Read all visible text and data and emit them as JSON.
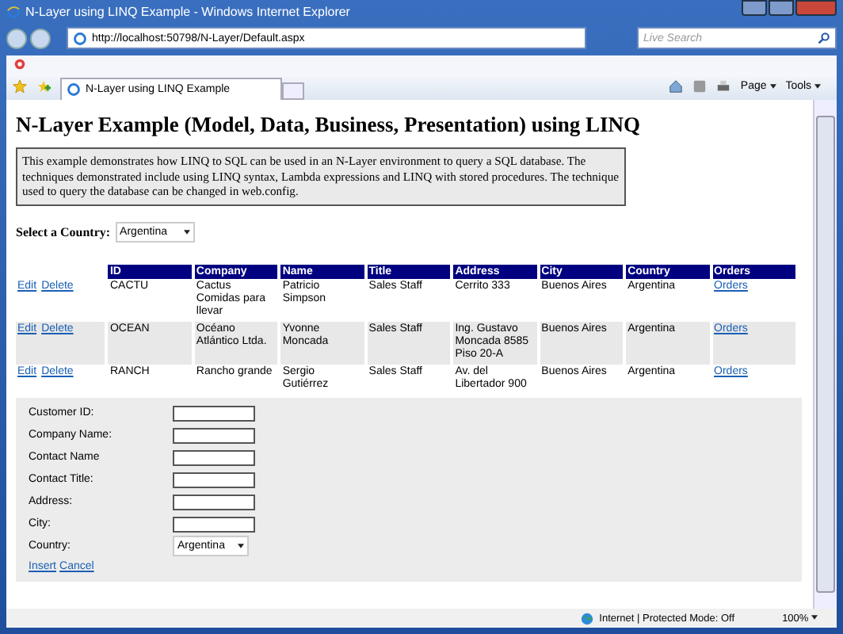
{
  "window": {
    "title": "N-Layer using LINQ Example - Windows Internet Explorer"
  },
  "browser": {
    "address": "http://localhost:50798/N-Layer/Default.aspx",
    "search_placeholder": "Live Search",
    "tab_title": "N-Layer using LINQ Example",
    "menus": [
      "Page",
      "Tools"
    ]
  },
  "page": {
    "heading": "N-Layer Example (Model, Data, Business, Presentation) using LINQ",
    "description": "This example demonstrates how LINQ to SQL can be used in an N-Layer environment to query a SQL database. The techniques demonstrated include using LINQ syntax, Lambda expressions and LINQ with stored procedures. The technique used to query the database can be changed in web.config.",
    "country_label": "Select a Country:",
    "country_value": "Argentina"
  },
  "table": {
    "columns": [
      "ID",
      "Company",
      "Name",
      "Title",
      "Address",
      "City",
      "Country",
      "Orders"
    ],
    "rows": [
      {
        "actions": [
          "Edit",
          "Delete"
        ],
        "cells": [
          "CACTU",
          "Cactus Comidas para llevar",
          "Patricio Simpson",
          "Sales Staff",
          "Cerrito 333",
          "Buenos Aires",
          "Argentina"
        ],
        "link": "Orders"
      },
      {
        "actions": [
          "Edit",
          "Delete"
        ],
        "cells": [
          "OCEAN",
          "Océano Atlántico Ltda.",
          "Yvonne Moncada",
          "Sales Staff",
          "Ing. Gustavo Moncada 8585 Piso 20-A",
          "Buenos Aires",
          "Argentina"
        ],
        "link": "Orders"
      },
      {
        "actions": [
          "Edit",
          "Delete"
        ],
        "cells": [
          "RANCH",
          "Rancho grande",
          "Sergio Gutiérrez",
          "Sales Staff",
          "Av. del Libertador 900",
          "Buenos Aires",
          "Argentina"
        ],
        "link": "Orders"
      }
    ]
  },
  "form": {
    "fields": [
      {
        "label": "Customer ID:",
        "kind": "text"
      },
      {
        "label": "Company Name:",
        "kind": "text"
      },
      {
        "label": "Contact Name",
        "kind": "text"
      },
      {
        "label": "Contact Title:",
        "kind": "text"
      },
      {
        "label": "Address:",
        "kind": "text"
      },
      {
        "label": "City:",
        "kind": "text"
      },
      {
        "label": "Country:",
        "kind": "select",
        "value": "Argentina"
      }
    ],
    "actions": [
      "Insert",
      "Cancel"
    ]
  },
  "status_bar": {
    "zone": "Internet | Protected Mode: Off",
    "zoom": "100%"
  }
}
